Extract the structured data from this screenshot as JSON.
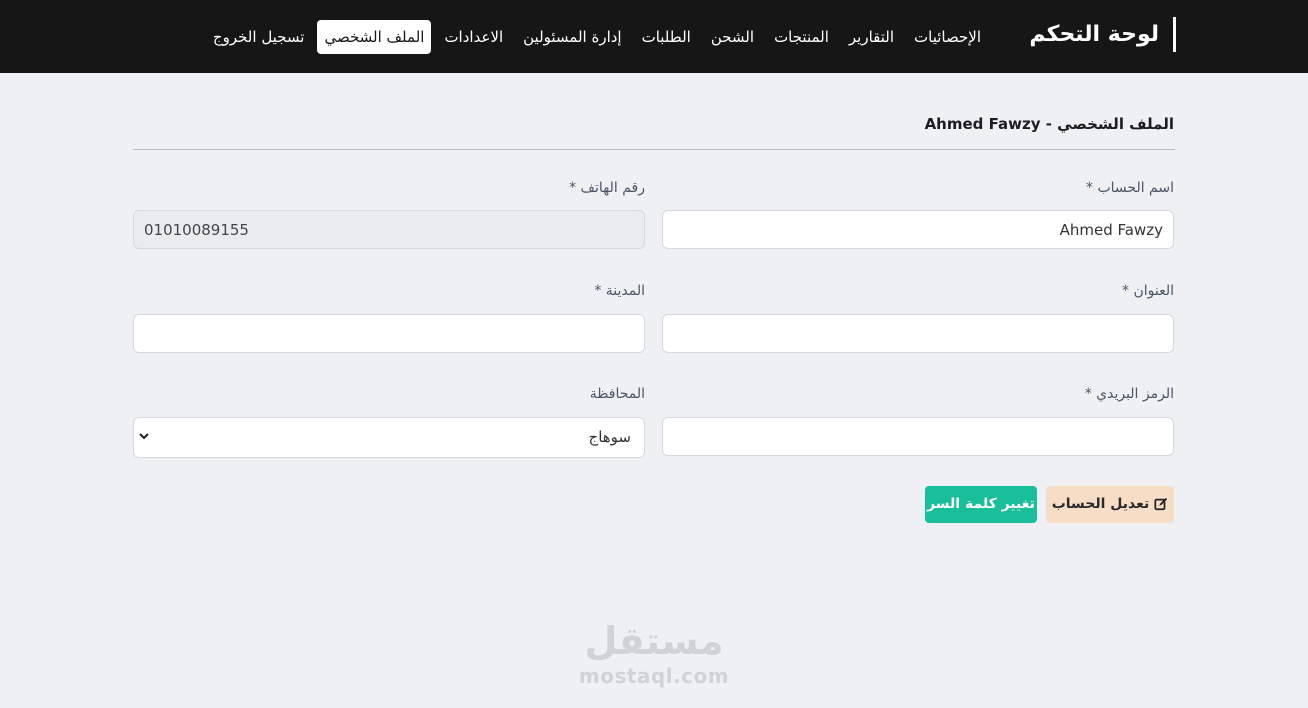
{
  "navbar": {
    "brand": "لوحة التحكم",
    "links": [
      {
        "label": "الإحصائيات"
      },
      {
        "label": "التقارير"
      },
      {
        "label": "المنتجات"
      },
      {
        "label": "الشحن"
      },
      {
        "label": "الطلبات"
      },
      {
        "label": "إدارة المسئولين"
      },
      {
        "label": "الاعدادات"
      },
      {
        "label": "الملف الشخصي",
        "active": true
      },
      {
        "label": "تسجيل الخروج"
      }
    ]
  },
  "page": {
    "title": "الملف الشخصي - Ahmed Fawzy"
  },
  "form": {
    "account_name": {
      "label": "اسم الحساب *",
      "value": "Ahmed Fawzy"
    },
    "phone": {
      "label": "رقم الهاتف *",
      "value": "01010089155"
    },
    "address": {
      "label": "العنوان *",
      "value": ""
    },
    "city": {
      "label": "المدينة *",
      "value": ""
    },
    "postal_code": {
      "label": "الرمز البريدي *",
      "value": ""
    },
    "governorate": {
      "label": "المحافظة",
      "selected": "سوهاج"
    }
  },
  "actions": {
    "edit_label": "تعديل الحساب",
    "change_password_label": "تغيير كلمة السر"
  },
  "watermark": {
    "arabic": "مستقل",
    "latin": "mostaql.com"
  },
  "icons": {
    "edit": "edit-icon",
    "select": "chevron-down-icon"
  },
  "colors": {
    "navbar": "#161616",
    "background": "#eef0f4",
    "edit_button": "#f7dcc6",
    "password_button": "#19bf9b"
  }
}
